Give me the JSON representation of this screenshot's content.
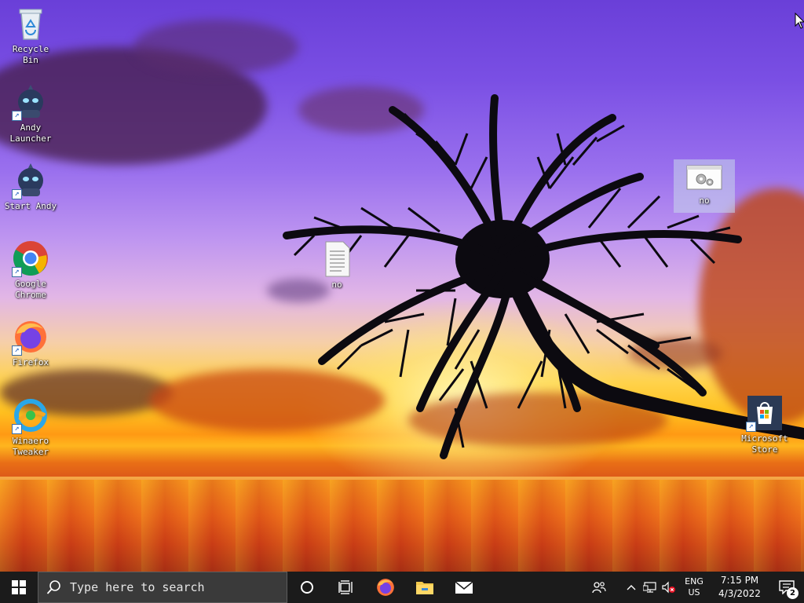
{
  "desktop_icons": [
    {
      "label": "Recycle\nBin",
      "icon": "recycle-bin-icon"
    },
    {
      "label": "Andy\nLauncher",
      "icon": "andy-icon"
    },
    {
      "label": "Start Andy",
      "icon": "andy-icon"
    },
    {
      "label": "Google\nChrome",
      "icon": "chrome-icon"
    },
    {
      "label": "Firefox",
      "icon": "firefox-icon"
    },
    {
      "label": "Winaero\nTweaker",
      "icon": "winaero-icon"
    },
    {
      "label": "no",
      "icon": "text-document-icon"
    },
    {
      "label": "no",
      "icon": "settings-file-icon"
    },
    {
      "label": "Microsoft\nStore",
      "icon": "microsoft-store-icon"
    }
  ],
  "taskbar": {
    "search_placeholder": "Type here to search",
    "pinned_apps": [
      "cortana-icon",
      "task-view-icon",
      "firefox-icon",
      "file-explorer-icon",
      "mail-icon"
    ],
    "language_line1": "ENG",
    "language_line2": "US",
    "time": "7:15 PM",
    "date": "4/3/2022",
    "notification_count": "2"
  },
  "colors": {
    "taskbar_bg": "#1b1b1b",
    "search_bg": "#3a3a3a",
    "accent_blue": "#1d5fbf"
  }
}
